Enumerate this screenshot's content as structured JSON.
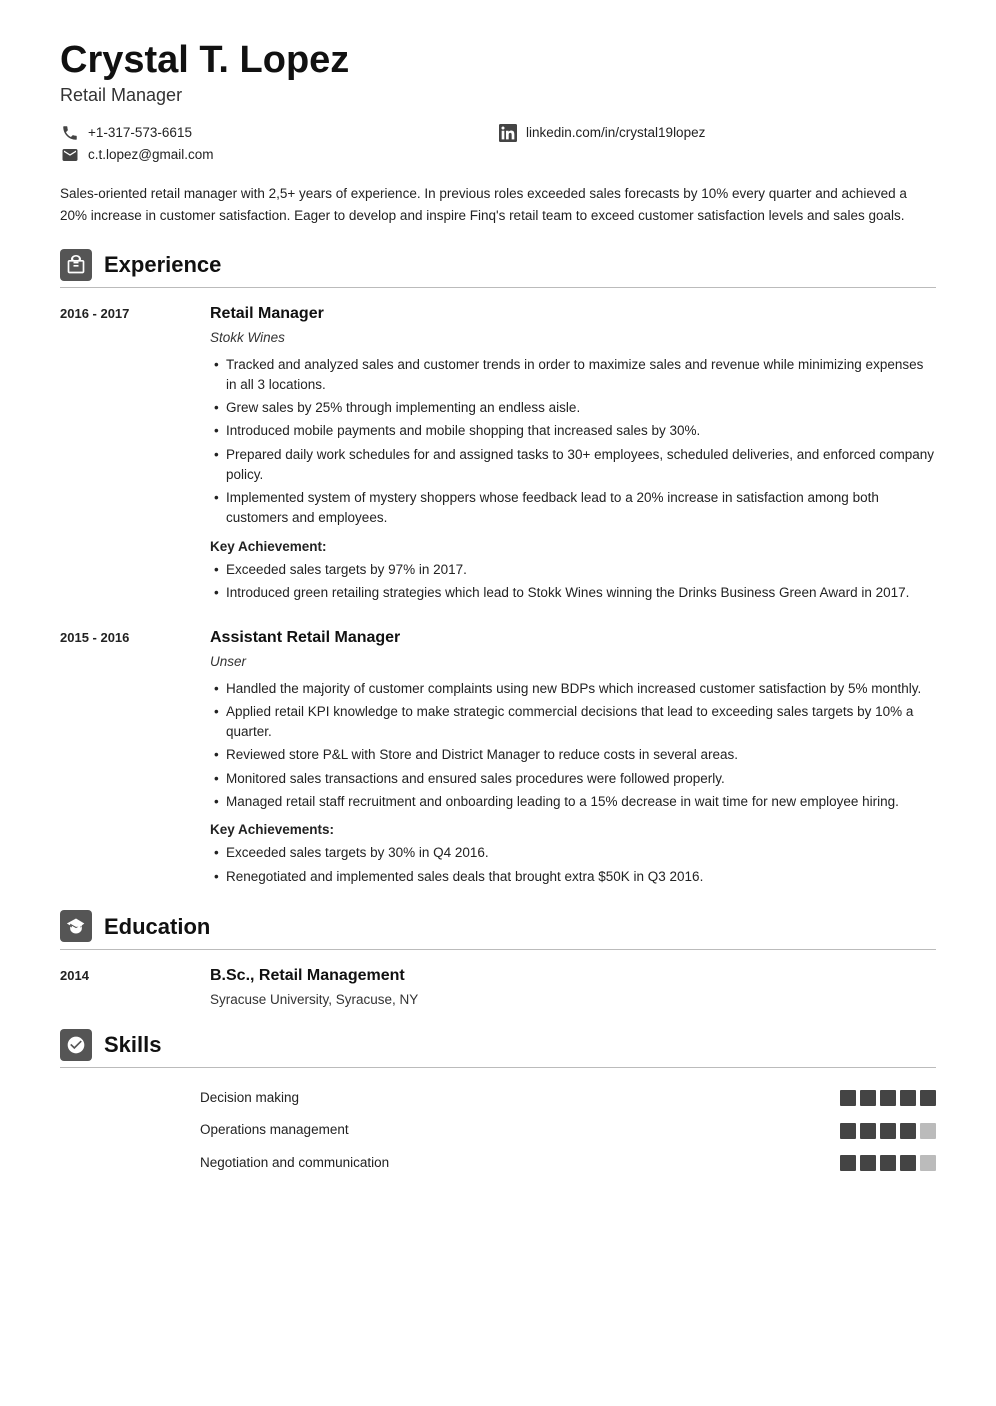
{
  "header": {
    "name": "Crystal T. Lopez",
    "title": "Retail Manager",
    "phone": "+1-317-573-6615",
    "linkedin": "linkedin.com/in/crystal19lopez",
    "email": "c.t.lopez@gmail.com"
  },
  "summary": "Sales-oriented retail manager with 2,5+ years of experience. In previous roles exceeded sales forecasts by 10% every quarter and achieved a 20% increase in customer satisfaction. Eager to develop and inspire Finq's retail team to exceed customer satisfaction levels and sales goals.",
  "experience": {
    "section_title": "Experience",
    "items": [
      {
        "dates": "2016 - 2017",
        "job_title": "Retail Manager",
        "company": "Stokk Wines",
        "bullets": [
          "Tracked and analyzed sales and customer trends in order to maximize sales and revenue while minimizing expenses in all 3 locations.",
          "Grew sales by 25% through implementing an endless aisle.",
          "Introduced mobile payments and mobile shopping that increased sales by 30%.",
          "Prepared daily work schedules for and assigned tasks to 30+ employees, scheduled deliveries, and enforced company policy.",
          "Implemented system of mystery shoppers whose feedback lead to a 20% increase in satisfaction among both customers and employees."
        ],
        "key_achievements_label": "Key Achievement:",
        "key_achievements": [
          "Exceeded sales targets by 97% in 2017.",
          "Introduced green retailing strategies which lead to Stokk Wines winning the Drinks Business Green Award in 2017."
        ]
      },
      {
        "dates": "2015 - 2016",
        "job_title": "Assistant Retail Manager",
        "company": "Unser",
        "bullets": [
          "Handled the majority of customer complaints using new BDPs which increased customer satisfaction by 5% monthly.",
          "Applied retail KPI knowledge to make strategic commercial decisions that lead to exceeding sales targets by 10% a quarter.",
          "Reviewed store P&L with Store and District Manager to reduce costs in several areas.",
          "Monitored sales transactions and ensured sales procedures were followed properly.",
          "Managed retail staff recruitment and onboarding leading to a 15% decrease in wait time for new employee hiring."
        ],
        "key_achievements_label": "Key Achievements:",
        "key_achievements": [
          "Exceeded sales targets by 30% in Q4 2016.",
          "Renegotiated and implemented sales deals that brought extra $50K in Q3 2016."
        ]
      }
    ]
  },
  "education": {
    "section_title": "Education",
    "items": [
      {
        "year": "2014",
        "degree": "B.Sc., Retail Management",
        "school": "Syracuse University, Syracuse, NY"
      }
    ]
  },
  "skills": {
    "section_title": "Skills",
    "items": [
      {
        "name": "Decision making",
        "filled": 5,
        "total": 5
      },
      {
        "name": "Operations management",
        "filled": 4,
        "total": 5
      },
      {
        "name": "Negotiation and communication",
        "filled": 4,
        "total": 5
      }
    ]
  }
}
